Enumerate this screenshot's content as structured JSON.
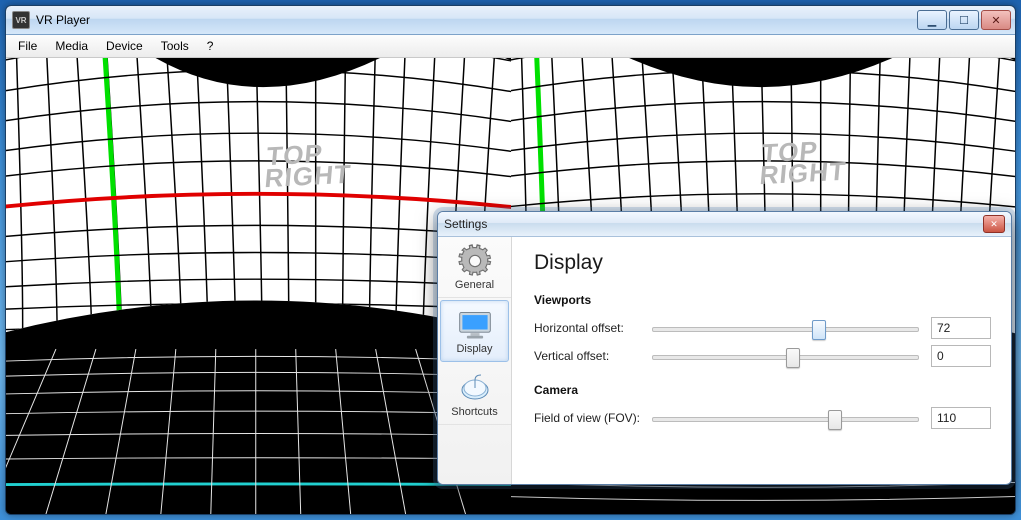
{
  "app": {
    "title": "VR Player",
    "icon_text": "VR",
    "menu": [
      "File",
      "Media",
      "Device",
      "Tools",
      "?"
    ],
    "window_buttons": {
      "min": "▁",
      "max": "☐",
      "close": "✕"
    }
  },
  "viewport": {
    "overlay_label_line1": "TOP",
    "overlay_label_line2": "RIGHT"
  },
  "settings": {
    "title": "Settings",
    "close": "✕",
    "tabs": [
      {
        "key": "general",
        "label": "General",
        "icon": "gear-icon"
      },
      {
        "key": "display",
        "label": "Display",
        "icon": "monitor-icon"
      },
      {
        "key": "shortcuts",
        "label": "Shortcuts",
        "icon": "mouse-icon"
      }
    ],
    "selected_tab": "display",
    "display_page": {
      "heading": "Display",
      "section_viewports": "Viewports",
      "section_camera": "Camera",
      "rows": {
        "horizontal_offset": {
          "label": "Horizontal offset:",
          "value": "72",
          "min": 0,
          "max": 120,
          "pos_pct": 60
        },
        "vertical_offset": {
          "label": "Vertical offset:",
          "value": "0",
          "min": -20,
          "max": 20,
          "pos_pct": 50
        },
        "fov": {
          "label": "Field of view (FOV):",
          "value": "110",
          "min": 60,
          "max": 180,
          "pos_pct": 66
        }
      }
    }
  }
}
